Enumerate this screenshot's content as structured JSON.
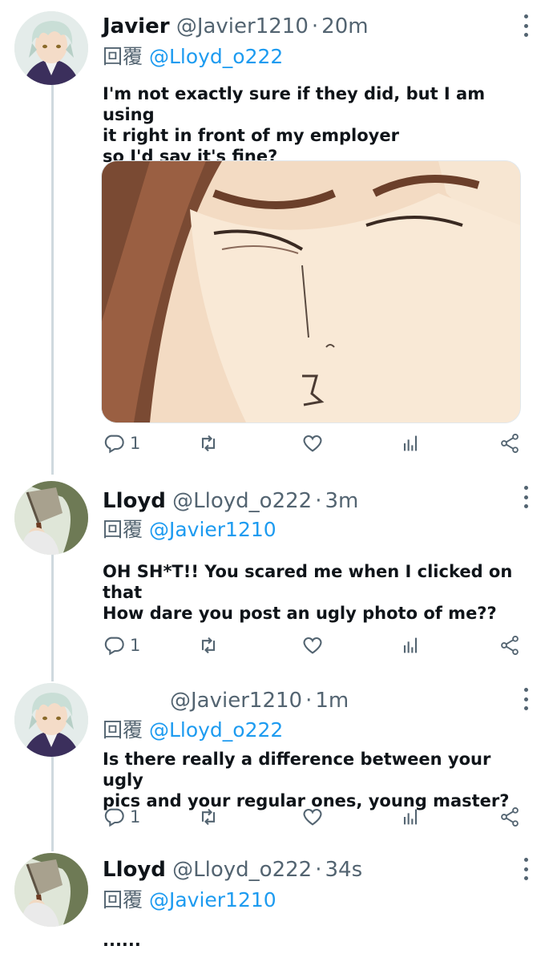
{
  "reply_prefix": "回覆",
  "colors": {
    "link": "#1d9bf0",
    "secondary": "#536471",
    "text": "#0f1419"
  },
  "tweets": [
    {
      "name": "Javier",
      "handle": "@Javier1210",
      "time": "20m",
      "reply_to": "@Lloyd_o222",
      "text": "I'm not exactly sure if they did, but I am using\nit right in front of my employer\nso I'd say it's fine?",
      "has_media": true,
      "replies": "1"
    },
    {
      "name": "Lloyd",
      "handle": "@Lloyd_o222",
      "time": "3m",
      "reply_to": "@Javier1210",
      "text": "OH SH*T!! You scared me when I clicked on that\nHow dare you post an ugly photo of me??",
      "replies": "1"
    },
    {
      "name": "",
      "handle": "@Javier1210",
      "time": "1m",
      "reply_to": "@Lloyd_o222",
      "text": "Is there really a difference between your ugly\npics and your regular ones, young master?",
      "replies": "1"
    },
    {
      "name": "Lloyd",
      "handle": "@Lloyd_o222",
      "time": "34s",
      "reply_to": "@Javier1210",
      "text": "......"
    }
  ],
  "icons": [
    "reply-icon",
    "retweet-icon",
    "like-icon",
    "views-icon",
    "share-icon",
    "more-icon"
  ]
}
